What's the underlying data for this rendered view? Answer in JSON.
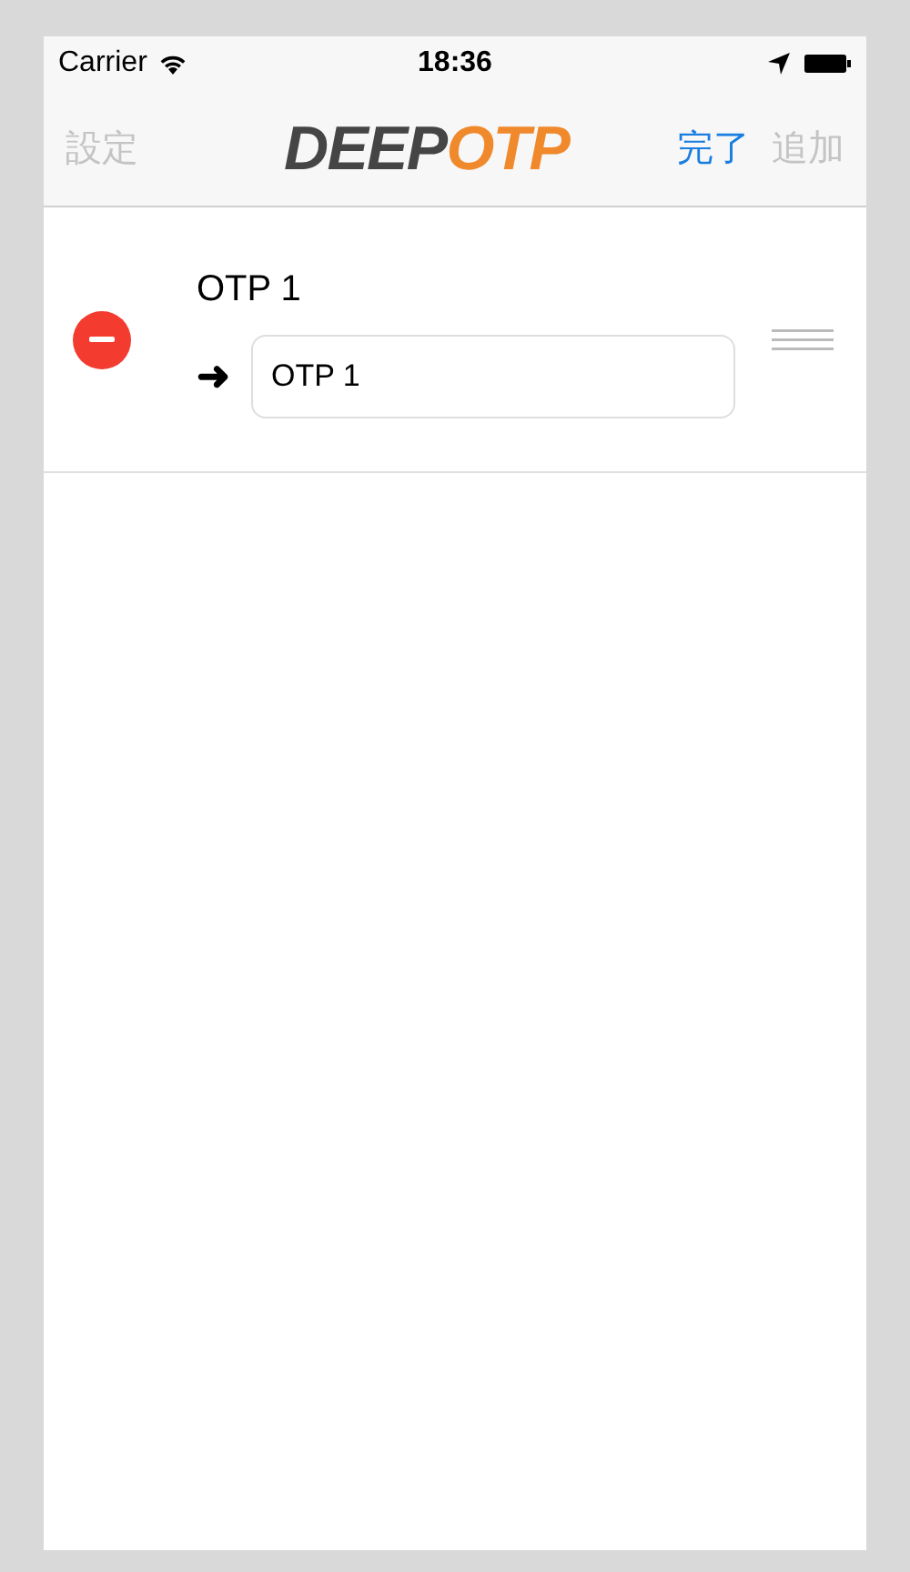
{
  "status_bar": {
    "carrier": "Carrier",
    "time": "18:36"
  },
  "nav_bar": {
    "left_button": {
      "label": "設定",
      "disabled": true
    },
    "logo": {
      "parts": [
        {
          "text": "DEEP",
          "color": "#454545"
        },
        {
          "text": "OTP",
          "color": "#f0892c"
        }
      ]
    },
    "right_buttons": [
      {
        "label": "完了",
        "disabled": false
      },
      {
        "label": "追加",
        "disabled": true
      }
    ]
  },
  "rows": [
    {
      "title": "OTP 1",
      "arrow": "➜",
      "value": "OTP 1"
    }
  ]
}
